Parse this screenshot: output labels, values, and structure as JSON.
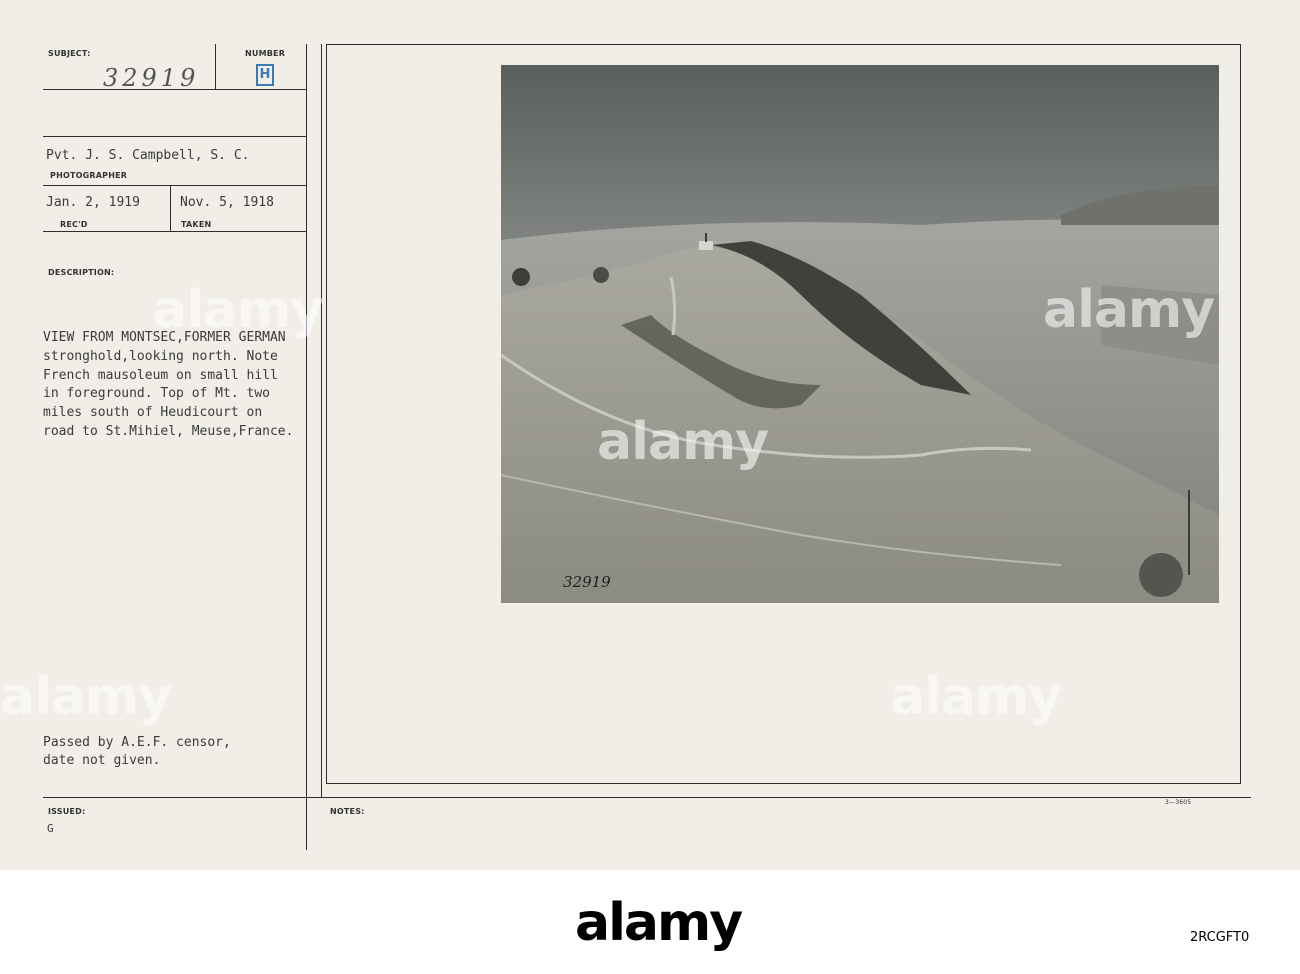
{
  "card": {
    "subject_label": "SUBJECT:",
    "number_label": "NUMBER",
    "subject_number": "32919",
    "number_stamp": "H",
    "photographer": "Pvt. J. S. Campbell, S. C.",
    "photographer_label": "PHOTOGRAPHER",
    "received_date": "Jan. 2, 1919",
    "received_label": "REC'D",
    "taken_date": "Nov. 5, 1918",
    "taken_label": "TAKEN",
    "description_label": "DESCRIPTION:",
    "description_lines": [
      "VIEW FROM MONTSEC,FORMER GERMAN",
      "stronghold,looking north. Note",
      "French mausoleum on small hill",
      "in foreground. Top of Mt. two",
      "miles south of Heudicourt on",
      "road to St.Mihiel, Meuse,France."
    ],
    "censor_lines": [
      "Passed by A.E.F. censor,",
      "date not given."
    ],
    "issued_label": "ISSUED:",
    "issued_value": "G",
    "notes_label": "NOTES:",
    "form_code": "3—3605",
    "photo_number": "32919"
  },
  "watermark": "alamy",
  "footer": {
    "logo": "alamy",
    "image_id": "2RCGFT0"
  }
}
